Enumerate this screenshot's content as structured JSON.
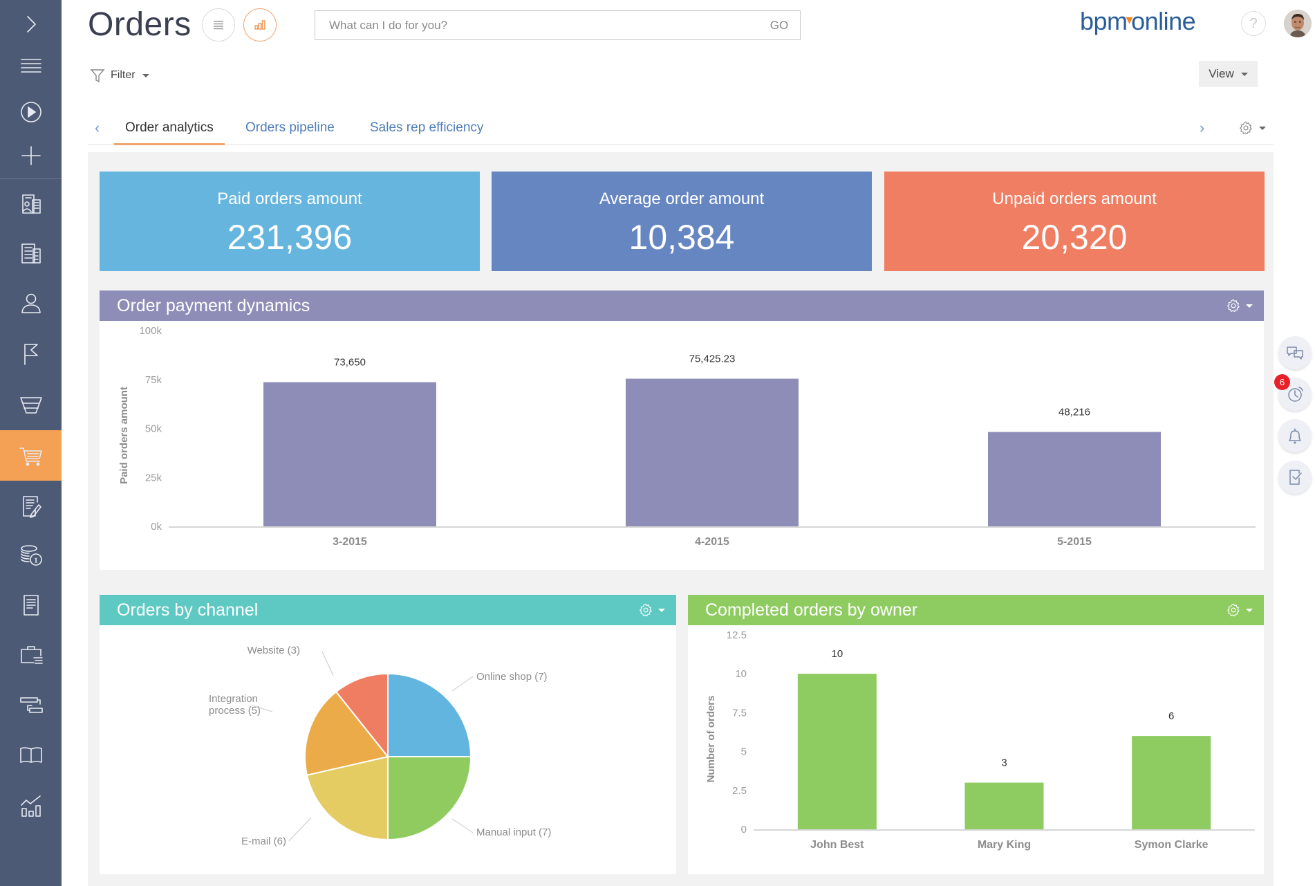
{
  "header": {
    "title": "Orders",
    "view_list_icon": "list-view-icon",
    "view_analytics_icon": "analytics-view-icon",
    "search": {
      "placeholder": "What can I do for you?",
      "value": "",
      "go_label": "GO"
    },
    "logo": {
      "left": "bpm",
      "dot": "▾",
      "right": "online"
    },
    "help_label": "?"
  },
  "toolbar": {
    "filter_label": "Filter",
    "view_label": "View"
  },
  "sidebar": {
    "items": [
      {
        "name": "expand",
        "icon": "chevron-right-icon",
        "active": false
      },
      {
        "name": "menu",
        "icon": "hamburger-icon",
        "active": false
      },
      {
        "name": "processes",
        "icon": "play-icon",
        "active": false
      },
      {
        "name": "add",
        "icon": "plus-icon",
        "active": false
      },
      {
        "name": "contacts-accounts",
        "icon": "contact-card-icon",
        "active": false
      },
      {
        "name": "accounts",
        "icon": "building-icon",
        "active": false
      },
      {
        "name": "contacts",
        "icon": "person-icon",
        "active": false
      },
      {
        "name": "leads",
        "icon": "flag-icon",
        "active": false
      },
      {
        "name": "opportunities",
        "icon": "funnel-icon",
        "active": false
      },
      {
        "name": "orders",
        "icon": "cart-icon",
        "active": true
      },
      {
        "name": "contracts",
        "icon": "document-pen-icon",
        "active": false
      },
      {
        "name": "invoices",
        "icon": "coins-icon",
        "active": false
      },
      {
        "name": "documents",
        "icon": "document-icon",
        "active": false
      },
      {
        "name": "projects",
        "icon": "briefcase-icon",
        "active": false
      },
      {
        "name": "gantt",
        "icon": "gantt-icon",
        "active": false
      },
      {
        "name": "knowledge-base",
        "icon": "book-icon",
        "active": false
      },
      {
        "name": "analytics",
        "icon": "chart-icon",
        "active": false
      }
    ]
  },
  "tabs": {
    "items": [
      {
        "label": "Order analytics",
        "active": true
      },
      {
        "label": "Orders pipeline",
        "active": false
      },
      {
        "label": "Sales rep efficiency",
        "active": false
      }
    ],
    "prev_arrow": "‹",
    "next_arrow": "›"
  },
  "kpis": [
    {
      "label": "Paid orders amount",
      "value": "231,396",
      "color": "#65b5df"
    },
    {
      "label": "Average order amount",
      "value": "10,384",
      "color": "#6686c2"
    },
    {
      "label": "Unpaid orders amount",
      "value": "20,320",
      "color": "#ef7e63"
    }
  ],
  "panels": {
    "payment": {
      "title": "Order payment dynamics",
      "color": "#8e8db7"
    },
    "channel": {
      "title": "Orders by channel",
      "color": "#5ec8c3"
    },
    "owner": {
      "title": "Completed orders by owner",
      "color": "#8ecb60"
    }
  },
  "right_rail": {
    "items": [
      {
        "name": "chat",
        "icon": "chat-bubbles-icon"
      },
      {
        "name": "reminders",
        "icon": "alarm-clock-icon",
        "badge": "6"
      },
      {
        "name": "notifications",
        "icon": "bell-icon"
      },
      {
        "name": "tasks",
        "icon": "task-check-icon"
      }
    ],
    "badge_color": "#e8202a"
  },
  "chart_data": [
    {
      "id": "payment",
      "type": "bar",
      "title": "Order payment dynamics",
      "categories": [
        "3-2015",
        "4-2015",
        "5-2015"
      ],
      "values": [
        73650,
        75425.23,
        48216
      ],
      "data_labels": [
        "73,650",
        "75,425.23",
        "48,216"
      ],
      "xlabel": "",
      "ylabel": "Paid orders amount",
      "ylim": [
        0,
        100000
      ],
      "yticks": [
        0,
        25000,
        50000,
        75000,
        100000
      ],
      "ytick_labels": [
        "0k",
        "25k",
        "50k",
        "75k",
        "100k"
      ],
      "color": "#8e8db7",
      "grid": false
    },
    {
      "id": "channel",
      "type": "pie",
      "title": "Orders by channel",
      "categories": [
        "Online shop",
        "Manual input",
        "E-mail",
        "Integration process",
        "Website"
      ],
      "values": [
        7,
        7,
        6,
        5,
        3
      ],
      "labels": [
        "Online shop (7)",
        "Manual input (7)",
        "E-mail (6)",
        "Integration process (5)",
        "Website (3)"
      ],
      "colors": [
        "#62b5de",
        "#8fcb5f",
        "#e5cc62",
        "#ebab48",
        "#ee7d62"
      ],
      "start": "12 o'clock, clockwise"
    },
    {
      "id": "owner",
      "type": "bar",
      "title": "Completed orders by owner",
      "categories": [
        "John Best",
        "Mary King",
        "Symon Clarke"
      ],
      "values": [
        10,
        3,
        6
      ],
      "data_labels": [
        "10",
        "3",
        "6"
      ],
      "xlabel": "",
      "ylabel": "Number of orders",
      "ylim": [
        0,
        12.5
      ],
      "yticks": [
        0,
        2.5,
        5,
        7.5,
        10,
        12.5
      ],
      "ytick_labels": [
        "0",
        "2.5",
        "5",
        "7.5",
        "10",
        "12.5"
      ],
      "color": "#8ecb60",
      "grid": false
    }
  ]
}
